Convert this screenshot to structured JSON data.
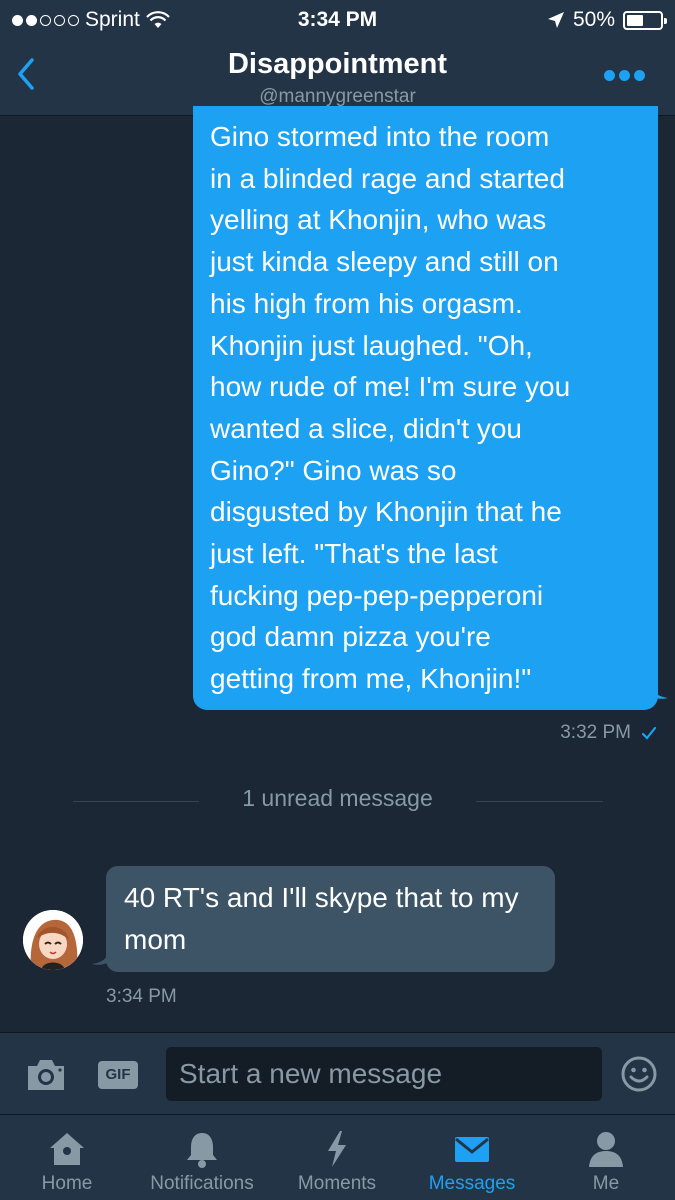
{
  "status_bar": {
    "carrier": "Sprint",
    "time": "3:34 PM",
    "battery": "50%",
    "battery_level": 0.5
  },
  "header": {
    "title": "Disappointment",
    "subtitle": "@mannygreenstar"
  },
  "messages": {
    "sent": {
      "text": "Gino stormed into the room\nin a blinded rage and started\nyelling at Khonjin, who was\njust kinda sleepy and still on\nhis high from his orgasm.\nKhonjin just laughed. \"Oh,\nhow rude of me! I'm sure you\nwanted a slice, didn't you\nGino?\" Gino was so\ndisgusted by Khonjin that he\njust left. \"That's the last\nfucking pep-pep-pepperoni\ngod damn pizza you're\ngetting from me, Khonjin!\"",
      "time": "3:32 PM"
    },
    "unread_divider": "1 unread message",
    "received": {
      "text": "40 RT's and I'll skype that to my mom",
      "time": "3:34 PM"
    }
  },
  "composer": {
    "gif_label": "GIF",
    "placeholder": "Start a new message"
  },
  "tabs": [
    {
      "label": "Home",
      "icon": "home-icon"
    },
    {
      "label": "Notifications",
      "icon": "bell-icon"
    },
    {
      "label": "Moments",
      "icon": "lightning-icon"
    },
    {
      "label": "Messages",
      "icon": "envelope-icon",
      "active": true
    },
    {
      "label": "Me",
      "icon": "person-icon"
    }
  ],
  "colors": {
    "background": "#1b2735",
    "bar": "#243447",
    "accent": "#1da1f2",
    "received_bubble": "#3d5466",
    "muted_text": "#8899a6"
  }
}
